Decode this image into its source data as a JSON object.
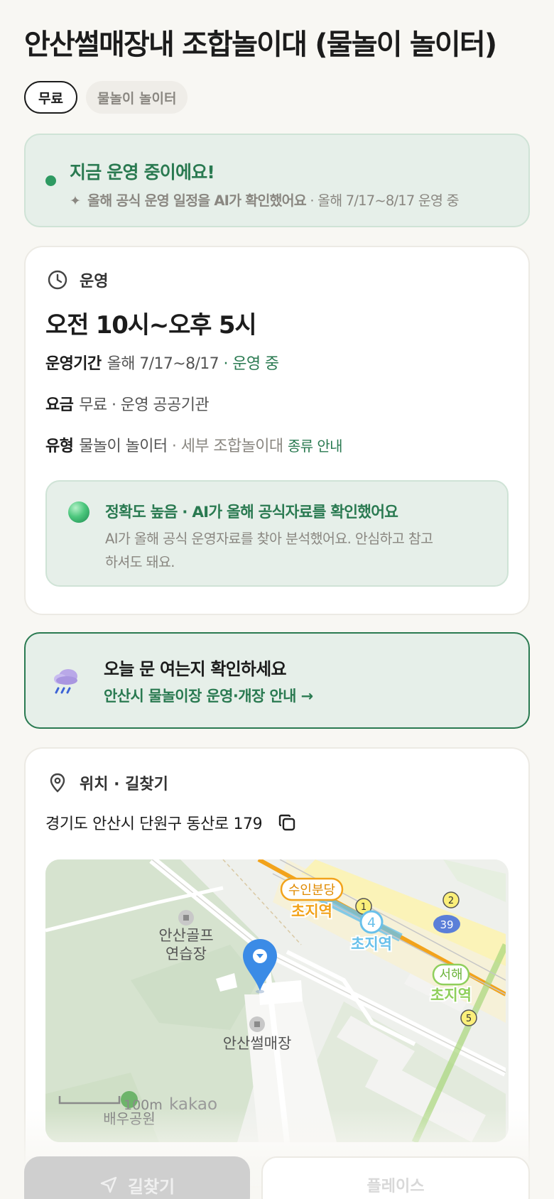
{
  "header": {
    "title": "안산썰매장내 조합놀이대 (물놀이 놀이터)",
    "chips": [
      "무료",
      "물놀이 놀이터"
    ]
  },
  "status": {
    "title": "지금 운영 중이에요!",
    "sub_bold": "올해 공식 운영 일정을 AI가 확인했어요",
    "sub_rest": " · 올해 7/17~8/17 운영 중",
    "colors": {
      "accent": "#2e9a62"
    }
  },
  "ops": {
    "head": "운영",
    "time": "오전 10시~오후 5시",
    "period_label": "운영기간",
    "period_value": "올해 7/17~8/17",
    "period_status": " · 운영 중",
    "fee_label": "요금",
    "fee_value": "무료 · 운영 공공기관",
    "type_label": "유형",
    "type_value": "물놀이 놀이터",
    "type_detail": " · 세부 조합놀이대 ",
    "type_link": "종류 안내",
    "accuracy_title": "정확도 높음 · AI가 올해 공식자료를 확인했어요",
    "accuracy_desc": "AI가 올해 공식 운영자료를 찾아 분석했어요. 안심하고 참고하셔도 돼요."
  },
  "notice": {
    "title": "오늘 문 여는지 확인하세요",
    "link": "안산시 물놀이장 운영·개장 안내 →"
  },
  "location": {
    "head": "위치 · 길찾기",
    "address": "경기도 안산시 단원구 동산로 179",
    "map": {
      "labels": {
        "golf": [
          "안산골프",
          "연습장"
        ],
        "sled": "안산썰매장",
        "station1": "수인분당",
        "station1_name": "초지역",
        "station2_name": "초지역",
        "station3": "서해",
        "station3_name": "초지역",
        "park": "배우공원",
        "scale": "100m",
        "brand": "kakao",
        "route_39": "39",
        "exit_1": "1",
        "exit_2": "2",
        "exit_5": "5",
        "line_4": "4"
      }
    }
  },
  "actions": {
    "primary": "길찾기",
    "secondary": "플레이스"
  }
}
